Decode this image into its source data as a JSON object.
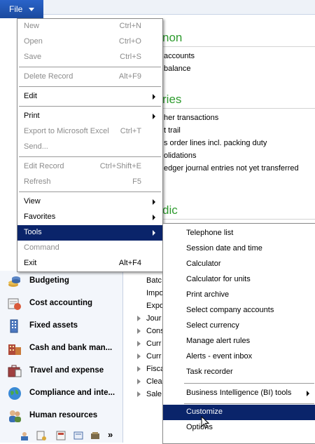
{
  "file_button": {
    "label": "File",
    "arrow_icon": "chevron-down-icon",
    "color": "#1f55b5"
  },
  "background": {
    "sections": [
      {
        "heading": "non"
      },
      {
        "heading": "ries"
      },
      {
        "heading": "dic"
      }
    ],
    "items": [
      "accounts",
      "balance",
      "her transactions",
      "t trail",
      "s order lines incl. packing duty",
      "olidations",
      "edger journal entries not yet transferred"
    ]
  },
  "file_menu": {
    "items": [
      {
        "label": "New",
        "shortcut": "Ctrl+N",
        "disabled": true
      },
      {
        "label": "Open",
        "shortcut": "Ctrl+O",
        "disabled": true
      },
      {
        "label": "Save",
        "shortcut": "Ctrl+S",
        "disabled": true
      },
      {
        "label": "Delete Record",
        "shortcut": "Alt+F9",
        "disabled": true
      },
      {
        "label": "Edit",
        "shortcut": "",
        "submenu": true
      },
      {
        "label": "Print",
        "shortcut": "",
        "submenu": true
      },
      {
        "label": "Export to Microsoft Excel",
        "shortcut": "Ctrl+T",
        "disabled": true
      },
      {
        "label": "Send...",
        "shortcut": "",
        "disabled": true
      },
      {
        "label": "Edit Record",
        "shortcut": "Ctrl+Shift+E",
        "disabled": true
      },
      {
        "label": "Refresh",
        "shortcut": "F5",
        "disabled": true
      },
      {
        "label": "View",
        "shortcut": "",
        "submenu": true
      },
      {
        "label": "Favorites",
        "shortcut": "",
        "submenu": true
      },
      {
        "label": "Tools",
        "shortcut": "",
        "submenu": true,
        "highlighted": true
      },
      {
        "label": "Command",
        "shortcut": "",
        "disabled": true
      },
      {
        "label": "Exit",
        "shortcut": "Alt+F4"
      }
    ],
    "highlight_color": "#0a246a"
  },
  "tools_menu": {
    "items": [
      {
        "label": "Telephone list"
      },
      {
        "label": "Session date and time"
      },
      {
        "label": "Calculator"
      },
      {
        "label": "Calculator for units"
      },
      {
        "label": "Print archive"
      },
      {
        "label": "Select company accounts"
      },
      {
        "label": "Select currency"
      },
      {
        "label": "Manage alert rules"
      },
      {
        "label": "Alerts - event inbox"
      },
      {
        "label": "Task recorder"
      },
      {
        "label": "Business Intelligence (BI) tools",
        "submenu": true
      },
      {
        "label": "Customize",
        "highlighted": true
      },
      {
        "label": "Options"
      }
    ]
  },
  "nav_pane": {
    "items": [
      {
        "label": "Budgeting",
        "icon": "budgeting-icon"
      },
      {
        "label": "Cost accounting",
        "icon": "cost-accounting-icon"
      },
      {
        "label": "Fixed assets",
        "icon": "fixed-assets-icon"
      },
      {
        "label": "Cash and bank man...",
        "icon": "cash-bank-icon"
      },
      {
        "label": "Travel and expense",
        "icon": "travel-expense-icon"
      },
      {
        "label": "Compliance and inte...",
        "icon": "compliance-icon"
      },
      {
        "label": "Human resources",
        "icon": "human-resources-icon"
      }
    ],
    "footer_overflow": "»"
  },
  "lower_list": {
    "items": [
      {
        "label": "Batc",
        "expandable": false
      },
      {
        "label": "Impo",
        "expandable": false
      },
      {
        "label": "Expo",
        "expandable": false
      },
      {
        "label": "Jour",
        "expandable": true
      },
      {
        "label": "Cons",
        "expandable": true
      },
      {
        "label": "Curr",
        "expandable": true
      },
      {
        "label": "Curr",
        "expandable": true
      },
      {
        "label": "Fisca",
        "expandable": true
      },
      {
        "label": "Clea",
        "expandable": true
      },
      {
        "label": "Sale",
        "expandable": true
      }
    ]
  }
}
